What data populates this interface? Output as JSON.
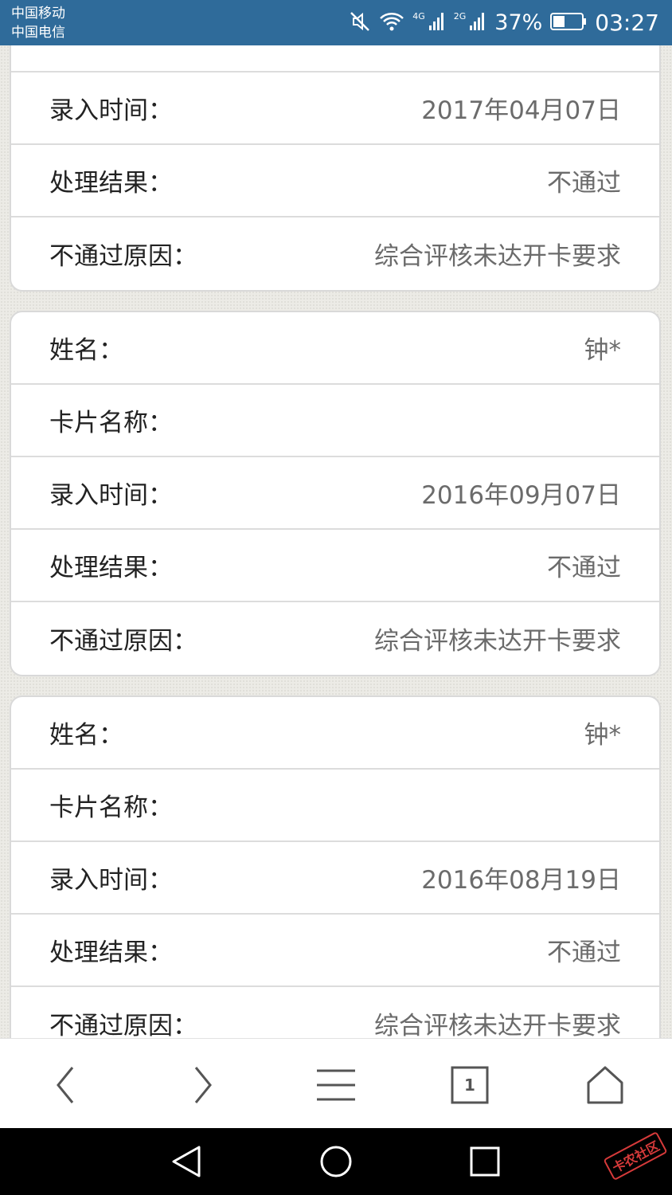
{
  "status_bar": {
    "carrier1": "中国移动",
    "carrier2": "中国电信",
    "signal1_label": "4G",
    "signal2_label": "2G",
    "battery": "37%",
    "time": "03:27"
  },
  "partial_card": {
    "rows": [
      {
        "label": "录入时间：",
        "value": "2017年04月07日"
      },
      {
        "label": "处理结果：",
        "value": "不通过"
      },
      {
        "label": "不通过原因：",
        "value": "综合评核未达开卡要求"
      }
    ]
  },
  "cards": [
    {
      "rows": [
        {
          "label": "姓名：",
          "value": "钟*"
        },
        {
          "label": "卡片名称：",
          "value": ""
        },
        {
          "label": "录入时间：",
          "value": "2016年09月07日"
        },
        {
          "label": "处理结果：",
          "value": "不通过"
        },
        {
          "label": "不通过原因：",
          "value": "综合评核未达开卡要求"
        }
      ]
    },
    {
      "rows": [
        {
          "label": "姓名：",
          "value": "钟*"
        },
        {
          "label": "卡片名称：",
          "value": ""
        },
        {
          "label": "录入时间：",
          "value": "2016年08月19日"
        },
        {
          "label": "处理结果：",
          "value": "不通过"
        },
        {
          "label": "不通过原因：",
          "value": "综合评核未达开卡要求"
        }
      ]
    }
  ],
  "toolbar": {
    "icons": [
      "back-icon",
      "forward-icon",
      "menu-icon",
      "tabs-icon",
      "home-icon"
    ],
    "tab_count": "1"
  },
  "navbar": {
    "icons": [
      "nav-back-icon",
      "nav-home-icon",
      "nav-recent-icon"
    ]
  },
  "watermark": "卡农社区",
  "colors": {
    "status_bar_bg": "#2f6b9a",
    "card_bg": "#ffffff",
    "value_text": "#6b6b6b"
  }
}
